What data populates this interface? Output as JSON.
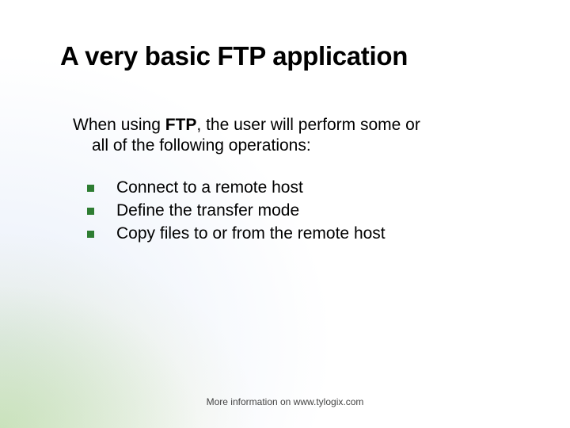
{
  "title": "A very basic FTP application",
  "intro": {
    "prefix": "When using ",
    "bold": "FTP",
    "line1_rest": ", the user will perform some or",
    "line2": "all of the following operations:"
  },
  "bullets": {
    "items": [
      "Connect to a remote host",
      "Define the transfer mode",
      "Copy files to or from the remote host"
    ]
  },
  "footer": "More information on www.tylogix.com"
}
